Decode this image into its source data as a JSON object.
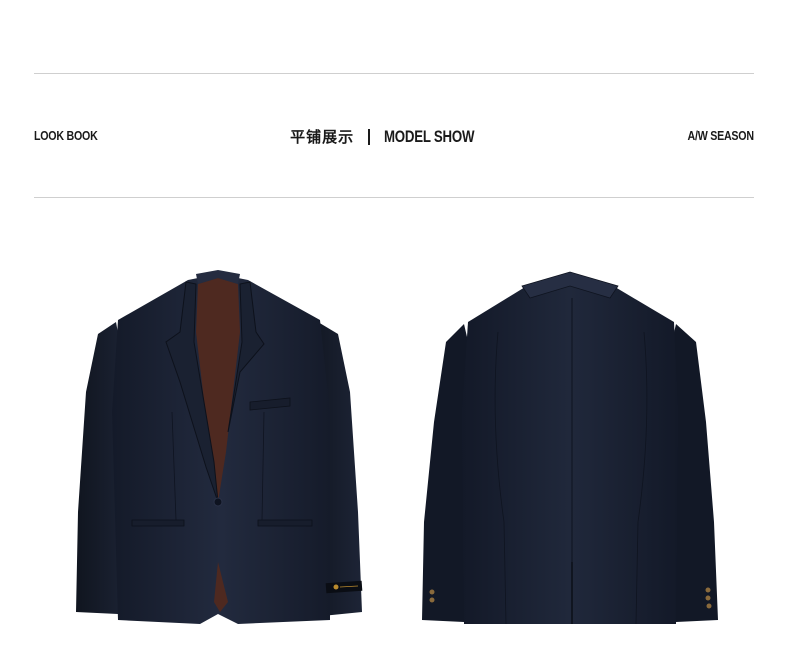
{
  "header": {
    "left_label": "LOOK BOOK",
    "center_cn": "平铺展示",
    "center_en": "MODEL SHOW",
    "right_label": "A/W SEASON"
  },
  "products": [
    {
      "view": "front",
      "icon": "jacket-front-image"
    },
    {
      "view": "back",
      "icon": "jacket-back-image"
    }
  ],
  "colors": {
    "jacket_navy": "#1c2233",
    "lining_brown": "#5a2f24",
    "rule_gray": "#cfcfcf",
    "text": "#1a1a1a"
  }
}
